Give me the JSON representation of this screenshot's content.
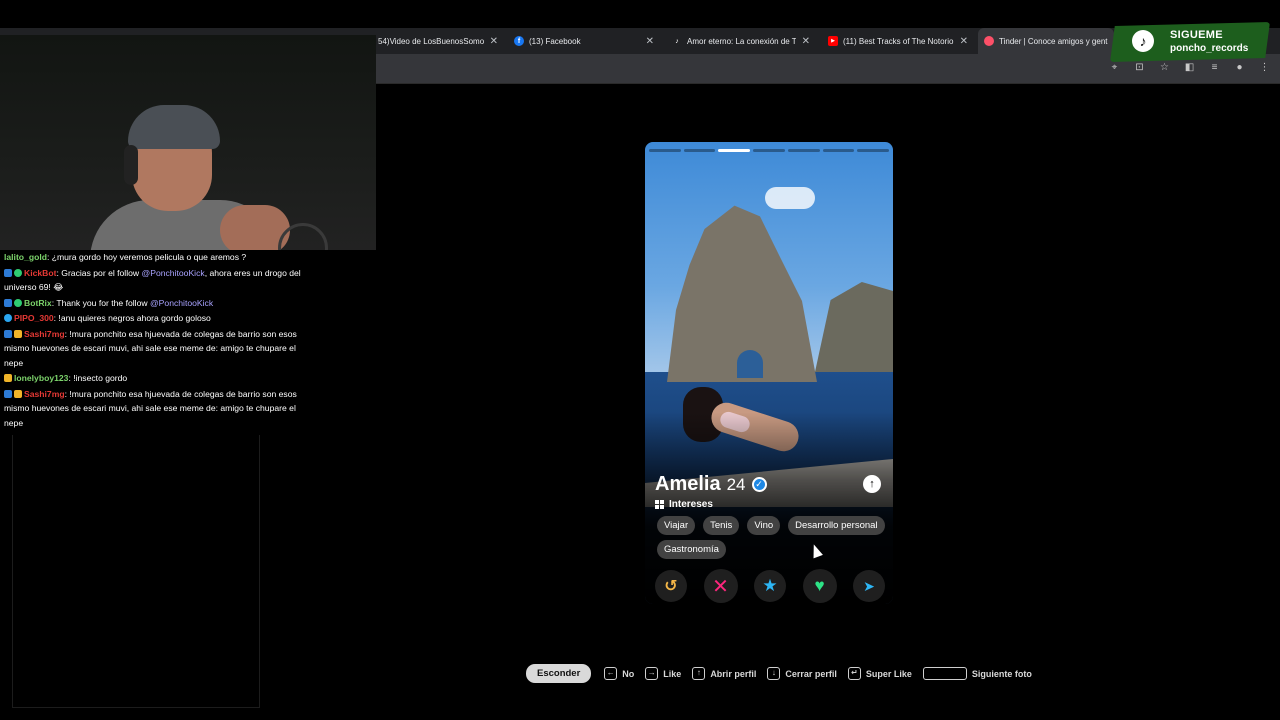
{
  "browser": {
    "tabs": [
      {
        "label": "54)Video de LosBuenosSomos",
        "icon": "video-icon",
        "color": "#5f6368",
        "active": false
      },
      {
        "label": "(13) Facebook",
        "icon": "facebook-icon",
        "color": "#1877f2",
        "active": false
      },
      {
        "label": "Amor eterno: La conexión de T",
        "icon": "tiktok-icon",
        "color": "#111111",
        "active": false
      },
      {
        "label": "(11) Best Tracks of The Notorio",
        "icon": "youtube-icon",
        "color": "#ff0000",
        "active": false
      },
      {
        "label": "Tinder | Conoce amigos y gent",
        "icon": "tinder-icon",
        "color": "#fd5068",
        "active": true
      }
    ],
    "toolbar_icons": [
      "location-icon",
      "install-icon",
      "star-icon",
      "extension-icon",
      "media-icon",
      "profile-icon",
      "menu-icon"
    ]
  },
  "follow_badge": {
    "line1": "SIGUEME",
    "line2": "poncho_records",
    "icon": "tiktok-icon"
  },
  "chat": {
    "messages": [
      {
        "user": "lalito_gold",
        "user_color": "#7cd36b",
        "text": ": ¿mura gordo hoy veremos pelicula o que aremos ?",
        "mention": "",
        "text_after": ""
      },
      {
        "user": "KickBot",
        "user_color": "#e53935",
        "text": ": Gracias por el follow ",
        "mention": "@PonchitooKick",
        "text_after": ", ahora eres un drogo del universo 69! 😂"
      },
      {
        "user": "BotRix",
        "user_color": "#7cd36b",
        "text": ": Thank you for the follow ",
        "mention": "@PonchitooKick",
        "text_after": ""
      },
      {
        "user": "PIPO_300",
        "user_color": "#e53935",
        "text": ": !anu quieres negros ahora gordo goloso",
        "mention": "",
        "text_after": ""
      },
      {
        "user": "Sashi7mg",
        "user_color": "#e53935",
        "text": ": !mura ponchito esa hjuevada de colegas de barrio son esos mismo huevones de escari muvi, ahi sale ese meme de: amigo te chupare el nepe",
        "mention": "",
        "text_after": ""
      },
      {
        "user": "lonelyboy123",
        "user_color": "#7cd36b",
        "text": ": !insecto gordo",
        "mention": "",
        "text_after": ""
      },
      {
        "user": "Sashi7mg",
        "user_color": "#e53935",
        "text": ": !mura ponchito esa hjuevada de colegas de barrio son esos mismo huevones de escari muvi, ahi sale ese meme de: amigo te chupare el nepe",
        "mention": "",
        "text_after": ""
      }
    ]
  },
  "profile": {
    "name": "Amelia",
    "age": "24",
    "verified": true,
    "photo_index": 3,
    "photo_count": 7,
    "interests_label": "Intereses",
    "interests": [
      "Viajar",
      "Tenis",
      "Vino",
      "Desarrollo personal",
      "Gastronomía"
    ]
  },
  "actions": [
    {
      "name": "rewind-button",
      "glyph": "↺",
      "color": "#f5b748"
    },
    {
      "name": "nope-button",
      "glyph": "✕",
      "color": "#fd267d"
    },
    {
      "name": "super-like-button",
      "glyph": "★",
      "color": "#2db6f5"
    },
    {
      "name": "like-button",
      "glyph": "♥",
      "color": "#2de386"
    },
    {
      "name": "boost-button",
      "glyph": "➤",
      "color": "#2db6f5"
    }
  ],
  "hints": {
    "hide": "Esconder",
    "items": [
      {
        "key": "←",
        "label": "No"
      },
      {
        "key": "→",
        "label": "Like"
      },
      {
        "key": "↑",
        "label": "Abrir perfil"
      },
      {
        "key": "↓",
        "label": "Cerrar perfil"
      },
      {
        "key": "↵",
        "label": "Super Like"
      },
      {
        "key": "",
        "label": "Siguiente foto"
      }
    ]
  }
}
